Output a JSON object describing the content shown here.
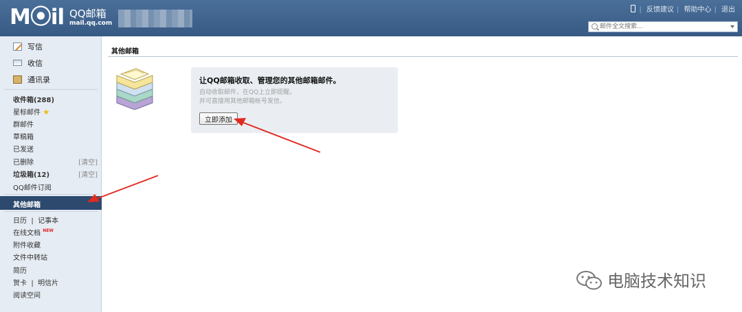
{
  "header": {
    "logo_text": "M⦿il",
    "logo_cn": "QQ邮箱",
    "logo_url": "mail.qq.com",
    "links": [
      "反馈建议",
      "帮助中心",
      "退出"
    ],
    "search_placeholder": "邮件全文搜索..."
  },
  "sidebar": {
    "actions": [
      {
        "label": "写信",
        "icon": "pencil-icon"
      },
      {
        "label": "收信",
        "icon": "envelope-icon"
      },
      {
        "label": "通讯录",
        "icon": "address-book-icon"
      }
    ],
    "folders": [
      {
        "label": "收件箱(288)",
        "bold": true
      },
      {
        "label": "星标邮件",
        "star": true
      },
      {
        "label": "群邮件"
      },
      {
        "label": "草稿箱"
      },
      {
        "label": "已发送"
      },
      {
        "label": "已删除",
        "clear": "[清空]"
      },
      {
        "label": "垃圾箱(12)",
        "bold": true,
        "clear": "[清空]"
      },
      {
        "label": "QQ邮件订阅"
      }
    ],
    "selected": "其他邮箱",
    "tools": {
      "calendar": "日历",
      "notes": "记事本",
      "docs": "在线文档",
      "docs_badge": "NEW",
      "attachments": "附件收藏",
      "transfer": "文件中转站",
      "resume": "简历",
      "card": "贺卡",
      "postcard": "明信片",
      "reading": "阅读空间"
    }
  },
  "main": {
    "title": "其他邮箱",
    "panel_heading": "让QQ邮箱收取、管理您的其他邮箱邮件。",
    "panel_desc1": "自动收取邮件，在QQ上立即提醒。",
    "panel_desc2": "并可直接用其他邮箱帐号发信。",
    "add_button": "立即添加"
  },
  "watermark": "电脑技术知识",
  "colors": {
    "header": "#3d6089",
    "sidebar": "#e6ecf3",
    "selected": "#2d4a6e",
    "arrow": "#e02a20"
  }
}
